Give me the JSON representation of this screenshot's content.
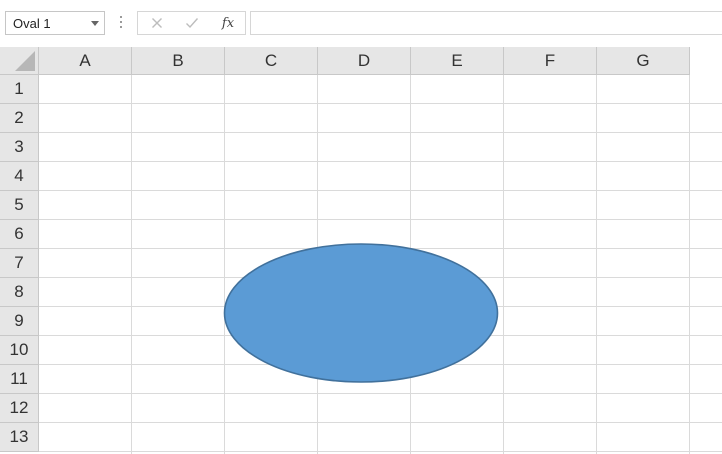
{
  "formula_bar": {
    "name_box_value": "Oval 1",
    "function_label": "fx",
    "formula_value": ""
  },
  "icons": {
    "name_box_dropdown": "chevron-down-icon",
    "more": "vertical-dots-icon",
    "cancel": "close-icon",
    "enter": "checkmark-icon",
    "insert_function": "fx-icon",
    "select_all": "select-all-triangle-icon"
  },
  "sheet": {
    "columns": [
      "A",
      "B",
      "C",
      "D",
      "E",
      "F",
      "G"
    ],
    "rows": [
      "1",
      "2",
      "3",
      "4",
      "5",
      "6",
      "7",
      "8",
      "9",
      "10",
      "11",
      "12",
      "13"
    ]
  },
  "shape": {
    "name": "Oval 1",
    "type": "oval",
    "fill": "#5b9bd5",
    "stroke": "#41719c"
  },
  "colors": {
    "header_bg": "#e6e6e6",
    "gridline": "#dadada",
    "header_border": "#c8c8c8"
  }
}
